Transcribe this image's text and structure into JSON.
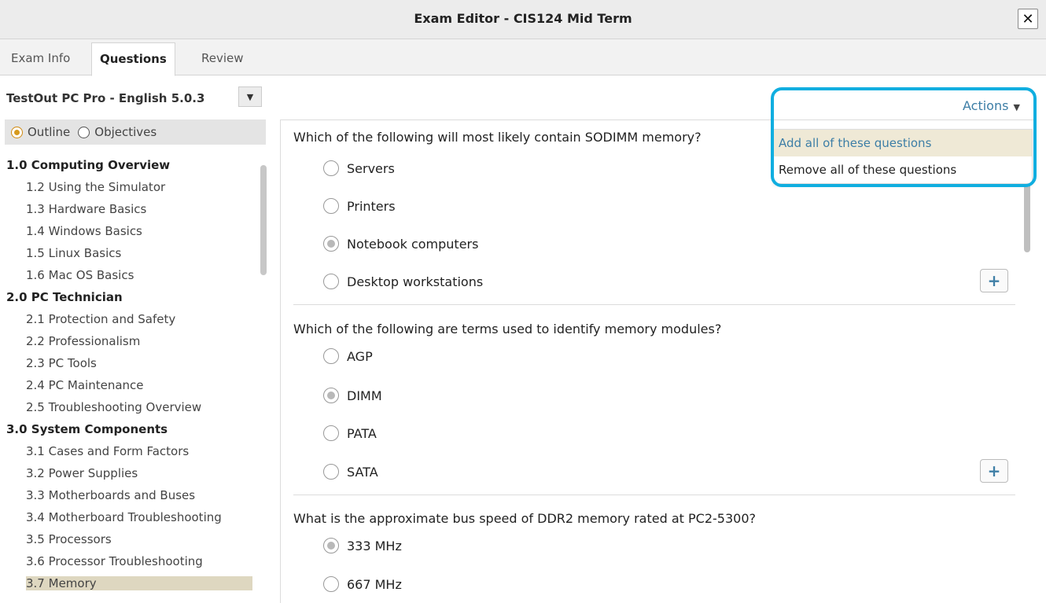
{
  "window": {
    "title": "Exam Editor - CIS124 Mid Term",
    "close_glyph": "✕"
  },
  "tabs": [
    {
      "label": "Exam Info"
    },
    {
      "label": "Questions"
    },
    {
      "label": "Review"
    }
  ],
  "course": {
    "label": "TestOut PC Pro - English 5.0.3",
    "dropdown_glyph": "▼"
  },
  "mode": {
    "outline_label": "Outline",
    "objectives_label": "Objectives",
    "selected": "Outline"
  },
  "outline": {
    "items": [
      {
        "text": "1.0 Computing Overview",
        "level": "section"
      },
      {
        "text": "1.2 Using the Simulator",
        "level": "sub"
      },
      {
        "text": "1.3 Hardware Basics",
        "level": "sub"
      },
      {
        "text": "1.4 Windows Basics",
        "level": "sub"
      },
      {
        "text": "1.5 Linux Basics",
        "level": "sub"
      },
      {
        "text": "1.6 Mac OS Basics",
        "level": "sub"
      },
      {
        "text": "2.0 PC Technician",
        "level": "section"
      },
      {
        "text": "2.1 Protection and Safety",
        "level": "sub"
      },
      {
        "text": "2.2 Professionalism",
        "level": "sub"
      },
      {
        "text": "2.3 PC Tools",
        "level": "sub"
      },
      {
        "text": "2.4 PC Maintenance",
        "level": "sub"
      },
      {
        "text": "2.5 Troubleshooting Overview",
        "level": "sub"
      },
      {
        "text": "3.0 System Components",
        "level": "section"
      },
      {
        "text": "3.1 Cases and Form Factors",
        "level": "sub"
      },
      {
        "text": "3.2 Power Supplies",
        "level": "sub"
      },
      {
        "text": "3.3 Motherboards and Buses",
        "level": "sub"
      },
      {
        "text": "3.4 Motherboard Troubleshooting",
        "level": "sub"
      },
      {
        "text": "3.5 Processors",
        "level": "sub"
      },
      {
        "text": "3.6 Processor Troubleshooting",
        "level": "sub"
      },
      {
        "text": "3.7 Memory",
        "level": "sub",
        "selected": true
      }
    ]
  },
  "actions": {
    "label": "Actions",
    "caret": "▼",
    "menu": [
      {
        "label": "Add all of these questions",
        "hover": true
      },
      {
        "label": "Remove all of these questions",
        "hover": false
      }
    ]
  },
  "questions": [
    {
      "text": "Which of the following will most likely contain SODIMM memory?",
      "options": [
        "Servers",
        "Printers",
        "Notebook computers",
        "Desktop workstations"
      ],
      "selected_index": 2
    },
    {
      "text": "Which of the following are terms used to identify memory modules?",
      "options": [
        "AGP",
        "DIMM",
        "PATA",
        "SATA"
      ],
      "selected_index": 1
    },
    {
      "text": "What is the approximate bus speed of DDR2 memory rated at PC2-5300?",
      "options": [
        "333 MHz",
        "667 MHz"
      ],
      "selected_index": 0
    }
  ],
  "add_button_glyph": "+",
  "colors": {
    "accent": "#3d7ea6",
    "highlight": "#10aee0",
    "selected_row": "#ded7c0",
    "menu_hover": "#efe9d6"
  }
}
